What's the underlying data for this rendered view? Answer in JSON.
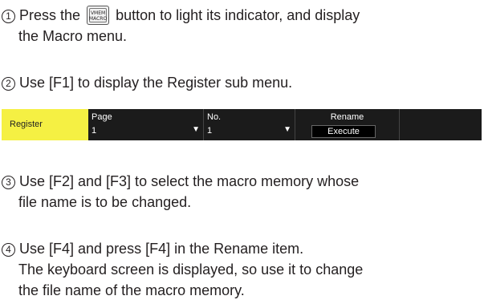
{
  "step1": {
    "number": "1",
    "text_before": "Press the",
    "button_label_top": "VMEM",
    "button_label_bottom": "MACRO",
    "text_after": "button to light its indicator, and display",
    "line2": "the Macro menu."
  },
  "step2": {
    "number": "2",
    "text": "Use [F1] to display the Register sub menu."
  },
  "menu": {
    "register_label": "Register",
    "page_label": "Page",
    "page_value": "1",
    "no_label": "No.",
    "no_value": "1",
    "rename_label": "Rename",
    "execute_label": "Execute",
    "arrow": "▼",
    "colors": {
      "highlight": "#f5f043",
      "background": "#1b1b1b"
    }
  },
  "step3": {
    "number": "3",
    "line1": "Use [F2] and [F3] to select the macro memory whose",
    "line2": "file name is to be changed."
  },
  "step4": {
    "number": "4",
    "line1": "Use [F4] and press [F4] in the Rename item.",
    "line2": "The keyboard screen is displayed, so use it to change",
    "line3": "the file name of the macro memory."
  }
}
